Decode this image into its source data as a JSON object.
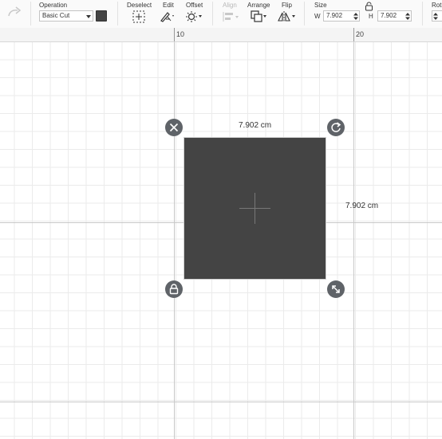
{
  "toolbar": {
    "operation": {
      "label": "Operation",
      "value": "Basic Cut",
      "swatch_color": "#444444"
    },
    "deselect": {
      "label": "Deselect"
    },
    "edit": {
      "label": "Edit"
    },
    "offset": {
      "label": "Offset"
    },
    "align": {
      "label": "Align"
    },
    "arrange": {
      "label": "Arrange"
    },
    "flip": {
      "label": "Flip"
    },
    "size": {
      "label": "Size",
      "w_label": "W",
      "w_value": "7.902",
      "h_label": "H",
      "h_value": "7.902"
    },
    "rotate": {
      "label": "Rot"
    }
  },
  "ruler": {
    "marks": [
      "10",
      "20"
    ]
  },
  "selection": {
    "width_text": "7.902 cm",
    "height_text": "7.902 cm",
    "fill_color": "#444444"
  },
  "icons": [
    "redo-icon",
    "dropdown-arrow-icon",
    "deselect-icon",
    "edit-icon",
    "offset-icon",
    "align-icon",
    "arrange-icon",
    "flip-icon",
    "lock-icon",
    "stepper-icon",
    "close-icon",
    "rotate-icon",
    "scale-icon",
    "crosshair-icon"
  ]
}
